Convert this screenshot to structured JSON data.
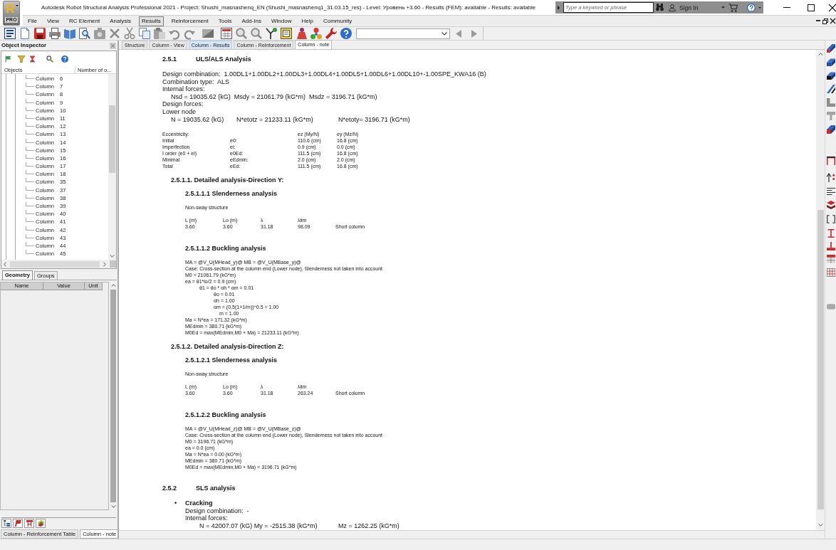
{
  "window": {
    "logo": {
      "mark": "R",
      "edition": "PRO"
    },
    "title": "Autodesk Robot Structural Analysis Professional 2021 - Project: Shushi_masnashenq_EN (Shushi_masnashenq1_31.03.15_res) - Level: Уровень +3.60 - Results (FEM): available - Results: available",
    "search": {
      "placeholder": "Type a keyword or phrase"
    },
    "sign_in": "Sign In"
  },
  "menu": [
    {
      "label": "File",
      "selected": false
    },
    {
      "label": "View",
      "selected": false
    },
    {
      "label": "RC Element",
      "selected": false
    },
    {
      "label": "Analysis",
      "selected": false
    },
    {
      "label": "Results",
      "selected": true
    },
    {
      "label": "Reinforcement",
      "selected": false
    },
    {
      "label": "Tools",
      "selected": false
    },
    {
      "label": "Add-Ins",
      "selected": false
    },
    {
      "label": "Window",
      "selected": false
    },
    {
      "label": "Help",
      "selected": false
    },
    {
      "label": "Community",
      "selected": false
    }
  ],
  "object_inspector": {
    "title": "Object Inspector",
    "tree": {
      "columns": [
        "Objects",
        "Number of o..."
      ],
      "items": [
        {
          "name": "Column",
          "number": "6"
        },
        {
          "name": "Column",
          "number": "7"
        },
        {
          "name": "Column",
          "number": "8"
        },
        {
          "name": "Column",
          "number": "9"
        },
        {
          "name": "Column",
          "number": "10"
        },
        {
          "name": "Column",
          "number": "11"
        },
        {
          "name": "Column",
          "number": "12"
        },
        {
          "name": "Column",
          "number": "13"
        },
        {
          "name": "Column",
          "number": "14"
        },
        {
          "name": "Column",
          "number": "15"
        },
        {
          "name": "Column",
          "number": "16"
        },
        {
          "name": "Column",
          "number": "17"
        },
        {
          "name": "Column",
          "number": "18"
        },
        {
          "name": "Column",
          "number": "35"
        },
        {
          "name": "Column",
          "number": "37"
        },
        {
          "name": "Column",
          "number": "38"
        },
        {
          "name": "Column",
          "number": "39"
        },
        {
          "name": "Column",
          "number": "40"
        },
        {
          "name": "Column",
          "number": "41"
        },
        {
          "name": "Column",
          "number": "42"
        },
        {
          "name": "Column",
          "number": "43"
        },
        {
          "name": "Column",
          "number": "44"
        },
        {
          "name": "Column",
          "number": "45"
        }
      ]
    },
    "tabs": [
      {
        "label": "Geometry",
        "selected": true
      },
      {
        "label": "Groups",
        "selected": false
      }
    ],
    "properties": {
      "columns": [
        "Name",
        "Value",
        "Unit"
      ]
    }
  },
  "view_tabs": [
    {
      "label": "Column - Reinforcement Table",
      "selected": false
    },
    {
      "label": "Column - note",
      "selected": true
    }
  ],
  "document": {
    "tabs": [
      {
        "label": "Structure",
        "selected": false,
        "highlighted": false
      },
      {
        "label": "Column - View",
        "selected": false,
        "highlighted": false
      },
      {
        "label": "Column - Results",
        "selected": false,
        "highlighted": true
      },
      {
        "label": "Column - Reinforcement",
        "selected": false,
        "highlighted": false
      },
      {
        "label": "Column - note",
        "selected": true,
        "highlighted": false
      }
    ],
    "report": [
      {
        "kind": "section",
        "number": "2.5.1",
        "title": "ULS/ALS Analysis",
        "content": [
          {
            "kind": "text",
            "lines": [
              {
                "text": "Design combination:  1.00DL1+1.00DL2+1.00DL3+1.00DL4+1.00DL5+1.00DL6+1.00DL10+-1.00SPE_KWA16 (B)"
              },
              {
                "text": "Combination type:  ALS"
              },
              {
                "text": "Internal forces:",
                "children": [
                  {
                    "text": "Nsd = 19035.62 (kG)  Msdy = 21061.79 (kG*m)  Msdz = 3196.71 (kG*m)"
                  }
                ]
              },
              {
                "text": "Design forces:"
              },
              {
                "text": "Lower node",
                "children": [
                  {
                    "parts": [
                      "N = 19035.62 (kG)",
                      "N*etotz = 21233.11 (kG*m)",
                      "N*etoty= 3196.71 (kG*m)"
                    ]
                  }
                ]
              }
            ]
          },
          {
            "kind": "eccentricity",
            "title": "Eccentricity:",
            "columns": [
              "ez (My/N)",
              "ey (Mz/N)"
            ],
            "rows": [
              {
                "label": "Initial",
                "symbol": "e0:",
                "values": [
                  "110.6 (cm)",
                  "16.8 (cm)"
                ]
              },
              {
                "label": "Imperfection",
                "symbol": "ei:",
                "values": [
                  "0.9 (cm)",
                  "0.0 (cm)"
                ]
              },
              {
                "label": "I order (e0 + ei)",
                "symbol": "e0Ed:",
                "values": [
                  "111.5 (cm)",
                  "16.8 (cm)"
                ]
              },
              {
                "label": "Minimal",
                "symbol": "eEdmin:",
                "values": [
                  "2.0 (cm)",
                  "2.0 (cm)"
                ]
              },
              {
                "label": "Total",
                "symbol": "eEd:",
                "values": [
                  "111.5 (cm)",
                  "16.8 (cm)"
                ]
              }
            ]
          },
          {
            "kind": "subsection",
            "title": "2.5.1.1. Detailed analysis-Direction Y:",
            "content": [
              {
                "kind": "subsubsection",
                "title": "2.5.1.1.1 Slenderness analysis",
                "content": [
                  {
                    "kind": "note",
                    "lines": [
                      {
                        "text": "Non-sway structure"
                      }
                    ]
                  },
                  {
                    "kind": "slenderness",
                    "columns": [
                      "L (m)",
                      "Lo (m)",
                      "λ",
                      "λlim"
                    ],
                    "values": [
                      "3.60",
                      "3.60",
                      "31.18",
                      "98.09"
                    ],
                    "result": "Short column"
                  }
                ]
              },
              {
                "kind": "subsubsection",
                "title": "2.5.1.1.2 Buckling analysis",
                "content": [
                  {
                    "kind": "note",
                    "lines": [
                      {
                        "text": "MA = @V_U(MHead_y)@ MB = @V_U(MBase_y)@"
                      },
                      {
                        "text": "Case: Cross-section at the column end (Lower node), Slenderness not taken into account"
                      },
                      {
                        "text": "M0 = 21061.79 (kG*m)"
                      },
                      {
                        "text": "ea = θ1*lo/2 = 0.9 (cm)",
                        "children": [
                          {
                            "text": "θ1 = θo * αh * αm = 0.01",
                            "children": [
                              {
                                "text": "θo = 0.01"
                              },
                              {
                                "text": "αh = 1.00"
                              },
                              {
                                "text": "αm = (0,5(1+1/m))^0.5 = 1.00",
                                "children": [
                                  {
                                    "text": "m = 1.00"
                                  }
                                ]
                              }
                            ]
                          }
                        ]
                      },
                      {
                        "text": "Ma = N*ea = 171.32 (kG*m)"
                      },
                      {
                        "text": "MEdmin = 380.71 (kG*m)"
                      },
                      {
                        "text": "M0Ed = max(MEdmin,M0 + Ma) = 21233.11 (kG*m)"
                      }
                    ]
                  }
                ]
              }
            ]
          },
          {
            "kind": "subsection",
            "title": "2.5.1.2. Detailed analysis-Direction Z:",
            "content": [
              {
                "kind": "subsubsection",
                "title": "2.5.1.2.1 Slenderness analysis",
                "content": [
                  {
                    "kind": "note",
                    "lines": [
                      {
                        "text": "Non-sway structure"
                      }
                    ]
                  },
                  {
                    "kind": "slenderness",
                    "columns": [
                      "L (m)",
                      "Lo (m)",
                      "λ",
                      "λlim"
                    ],
                    "values": [
                      "3.60",
                      "3.60",
                      "31.18",
                      "263.24"
                    ],
                    "result": "Short column"
                  }
                ]
              },
              {
                "kind": "subsubsection",
                "title": "2.5.1.2.2 Buckling analysis",
                "content": [
                  {
                    "kind": "note",
                    "lines": [
                      {
                        "text": "MA = @V_U(MHead_z)@ MB = @V_U(MBase_z)@"
                      },
                      {
                        "text": "Case: Cross-section at the column end (Lower node), Slenderness not taken into account"
                      },
                      {
                        "text": "M0 = 3196.71 (kG*m)"
                      },
                      {
                        "text": "ea = 0.0 (cm)"
                      },
                      {
                        "text": "Ma = N*ea = 0.00 (kG*m)"
                      },
                      {
                        "text": "MEdmin = 380.71 (kG*m)"
                      },
                      {
                        "text": "M0Ed = max(MEdmin,M0 + Ma) = 3196.71 (kG*m)"
                      }
                    ]
                  }
                ]
              }
            ]
          }
        ]
      },
      {
        "kind": "section",
        "number": "2.5.2",
        "title": "SLS analysis",
        "content": [
          {
            "kind": "bullet",
            "marker": "•",
            "title": "Cracking",
            "content": [
              {
                "kind": "text",
                "lines": [
                  {
                    "text": "Design combination:  -"
                  },
                  {
                    "text": "Internal forces:",
                    "children": [
                      {
                        "parts": [
                          "N = 42007.07 (kG) My = -2515.38 (kG*m)",
                          "Mz = 1262.25 (kG*m)"
                        ]
                      }
                    ]
                  }
                ]
              }
            ]
          }
        ]
      }
    ]
  }
}
